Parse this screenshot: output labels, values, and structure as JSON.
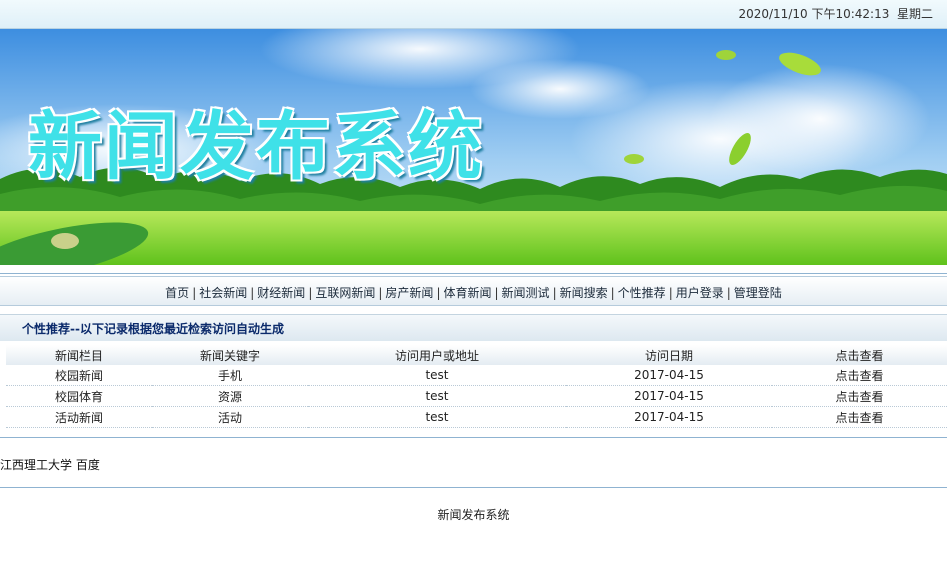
{
  "clock": {
    "datetime": "2020/11/10 下午10:42:13",
    "weekday": "星期二"
  },
  "banner": {
    "title": "新闻发布系统"
  },
  "nav": [
    {
      "label": "首页"
    },
    {
      "label": "社会新闻"
    },
    {
      "label": "财经新闻"
    },
    {
      "label": "互联网新闻"
    },
    {
      "label": "房产新闻"
    },
    {
      "label": "体育新闻"
    },
    {
      "label": "新闻测试"
    },
    {
      "label": "新闻搜索"
    },
    {
      "label": "个性推荐"
    },
    {
      "label": "用户登录"
    },
    {
      "label": "管理登陆"
    }
  ],
  "nav_separator": "|",
  "section": {
    "title": "个性推荐--以下记录根据您最近检索访问自动生成"
  },
  "table": {
    "headers": [
      "新闻栏目",
      "新闻关键字",
      "访问用户或地址",
      "访问日期",
      "点击查看"
    ],
    "rows": [
      [
        "校园新闻",
        "手机",
        "test",
        "2017-04-15",
        "点击查看"
      ],
      [
        "校园体育",
        "资源",
        "test",
        "2017-04-15",
        "点击查看"
      ],
      [
        "活动新闻",
        "活动",
        "test",
        "2017-04-15",
        "点击查看"
      ]
    ]
  },
  "footer_links": [
    "江西理工大学",
    "百度"
  ],
  "footer_text": "新闻发布系统"
}
